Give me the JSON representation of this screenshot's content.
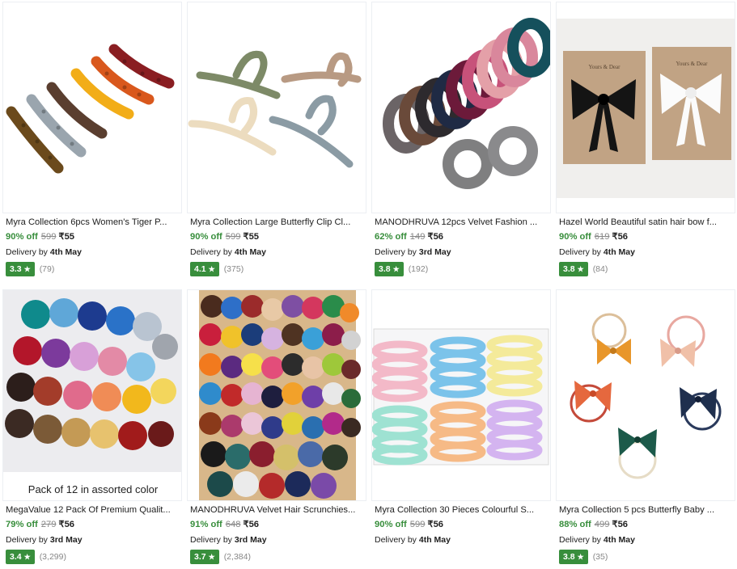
{
  "products": [
    {
      "title": "Myra Collection 6pcs Women's Tiger P...",
      "discount": "90% off",
      "mrp": "599",
      "price": "₹55",
      "delivery_prefix": "Delivery by",
      "delivery_date": "4th May",
      "rating": "3.3",
      "rating_count": "(79)"
    },
    {
      "title": "Myra Collection Large Butterfly Clip Cl...",
      "discount": "90% off",
      "mrp": "599",
      "price": "₹55",
      "delivery_prefix": "Delivery by",
      "delivery_date": "4th May",
      "rating": "4.1",
      "rating_count": "(375)"
    },
    {
      "title": "MANODHRUVA 12pcs Velvet Fashion ...",
      "discount": "62% off",
      "mrp": "149",
      "price": "₹56",
      "delivery_prefix": "Delivery by",
      "delivery_date": "3rd May",
      "rating": "3.8",
      "rating_count": "(192)"
    },
    {
      "title": "Hazel World Beautiful satin hair bow f...",
      "discount": "90% off",
      "mrp": "619",
      "price": "₹56",
      "delivery_prefix": "Delivery by",
      "delivery_date": "4th May",
      "rating": "3.8",
      "rating_count": "(84)",
      "card_text_left": "Yours & Dear",
      "card_text_right": "Yours & Dear"
    },
    {
      "title": "MegaValue 12 Pack Of Premium Qualit...",
      "discount": "79% off",
      "mrp": "279",
      "price": "₹56",
      "delivery_prefix": "Delivery by",
      "delivery_date": "3rd May",
      "rating": "3.4",
      "rating_count": "(3,299)",
      "image_caption": "Pack of 12 in assorted color"
    },
    {
      "title": "MANODHRUVA Velvet Hair Scrunchies...",
      "discount": "91% off",
      "mrp": "648",
      "price": "₹56",
      "delivery_prefix": "Delivery by",
      "delivery_date": "3rd May",
      "rating": "3.7",
      "rating_count": "(2,384)"
    },
    {
      "title": "Myra Collection 30 Pieces Colourful S...",
      "discount": "90% off",
      "mrp": "599",
      "price": "₹56",
      "delivery_prefix": "Delivery by",
      "delivery_date": "4th May"
    },
    {
      "title": "Myra Collection 5 pcs Butterfly Baby ...",
      "discount": "88% off",
      "mrp": "499",
      "price": "₹56",
      "delivery_prefix": "Delivery by",
      "delivery_date": "4th May",
      "rating": "3.8",
      "rating_count": "(35)"
    }
  ],
  "colors": {
    "discount_green": "#388e3c",
    "rating_badge": "#388e3c",
    "strike_gray": "#878787"
  },
  "icons": {
    "rating": "star-icon"
  }
}
